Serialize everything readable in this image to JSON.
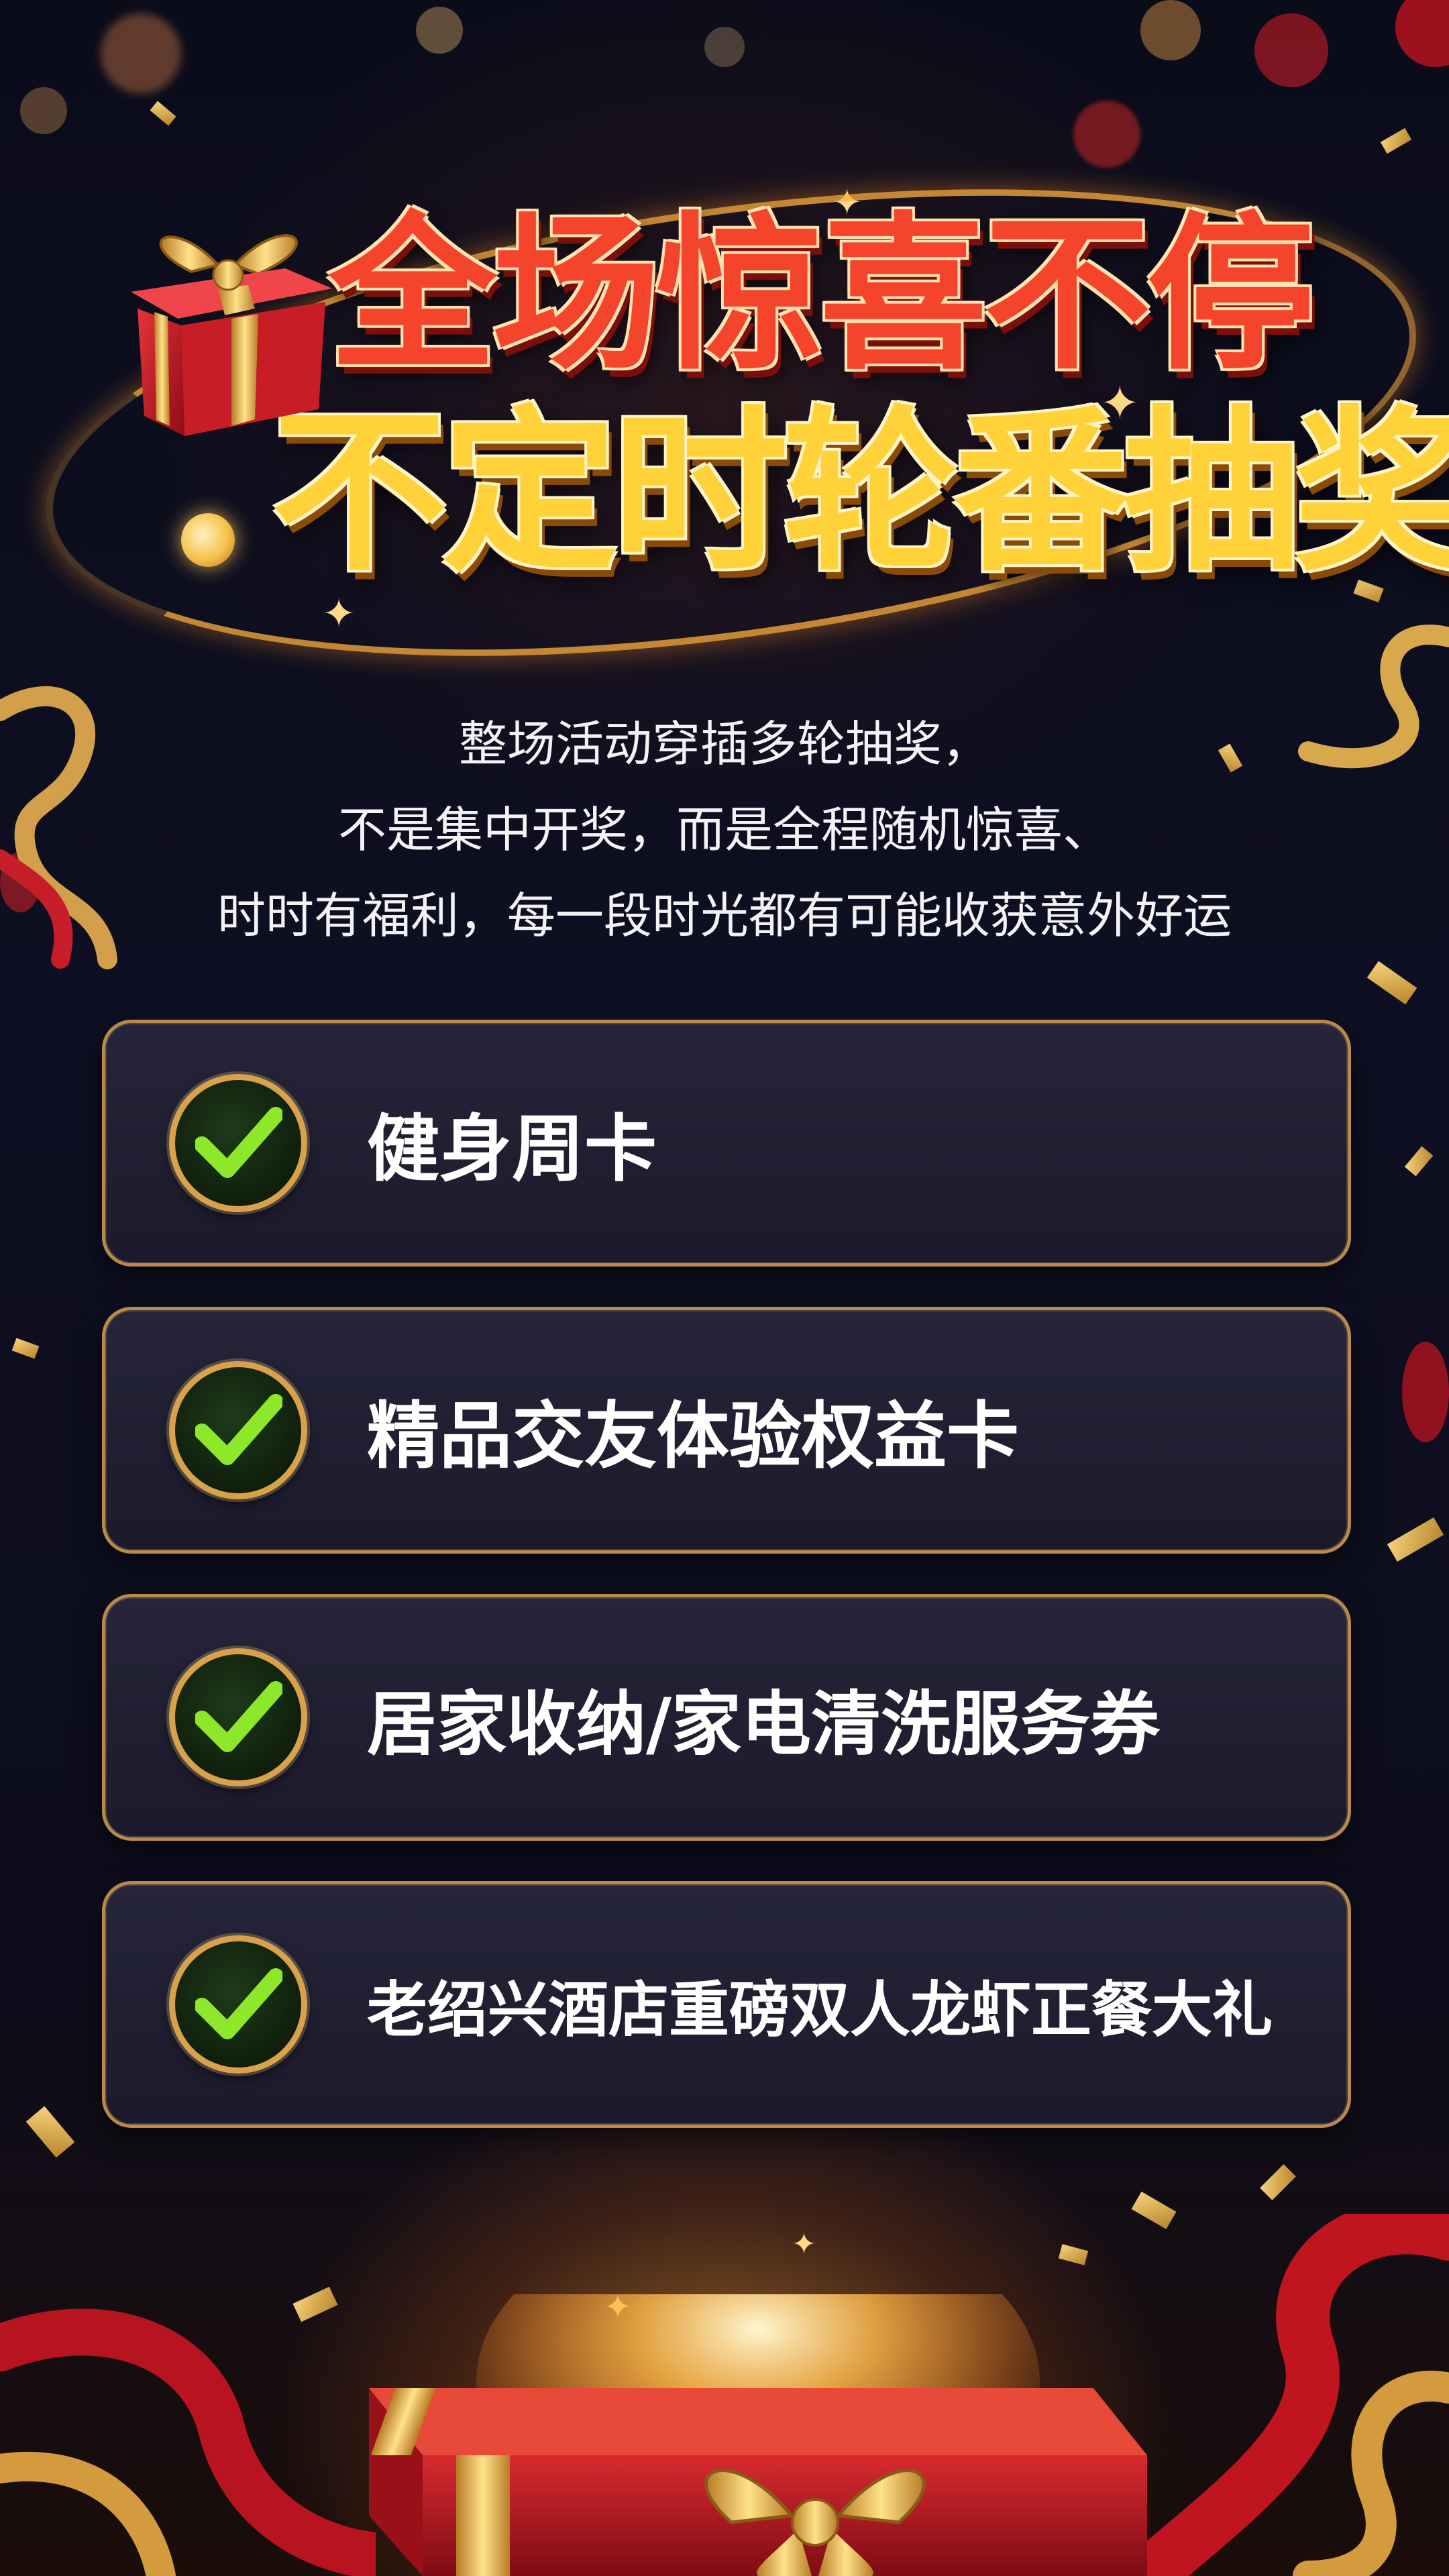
{
  "headline": {
    "line1": "全场惊喜不停",
    "line2": "不定时轮番抽奖"
  },
  "description": {
    "lines": [
      "整场活动穿插多轮抽奖，",
      "不是集中开奖，而是全程随机惊喜、",
      "时时有福利，每一段时光都有可能收获意外好运"
    ]
  },
  "prizes": [
    {
      "label": "健身周卡",
      "icon": "check-icon"
    },
    {
      "label": "精品交友体验权益卡",
      "icon": "check-icon"
    },
    {
      "label": "居家收纳/家电清洗服务券",
      "icon": "check-icon"
    },
    {
      "label": "老绍兴酒店重磅双人龙虾正餐大礼",
      "icon": "check-icon"
    }
  ],
  "colors": {
    "background": "#0c0d1c",
    "headline_red": "#f4442c",
    "headline_gold": "#ffd23a",
    "card_border": "#b98a4a",
    "check_green": "#8ee82a"
  }
}
